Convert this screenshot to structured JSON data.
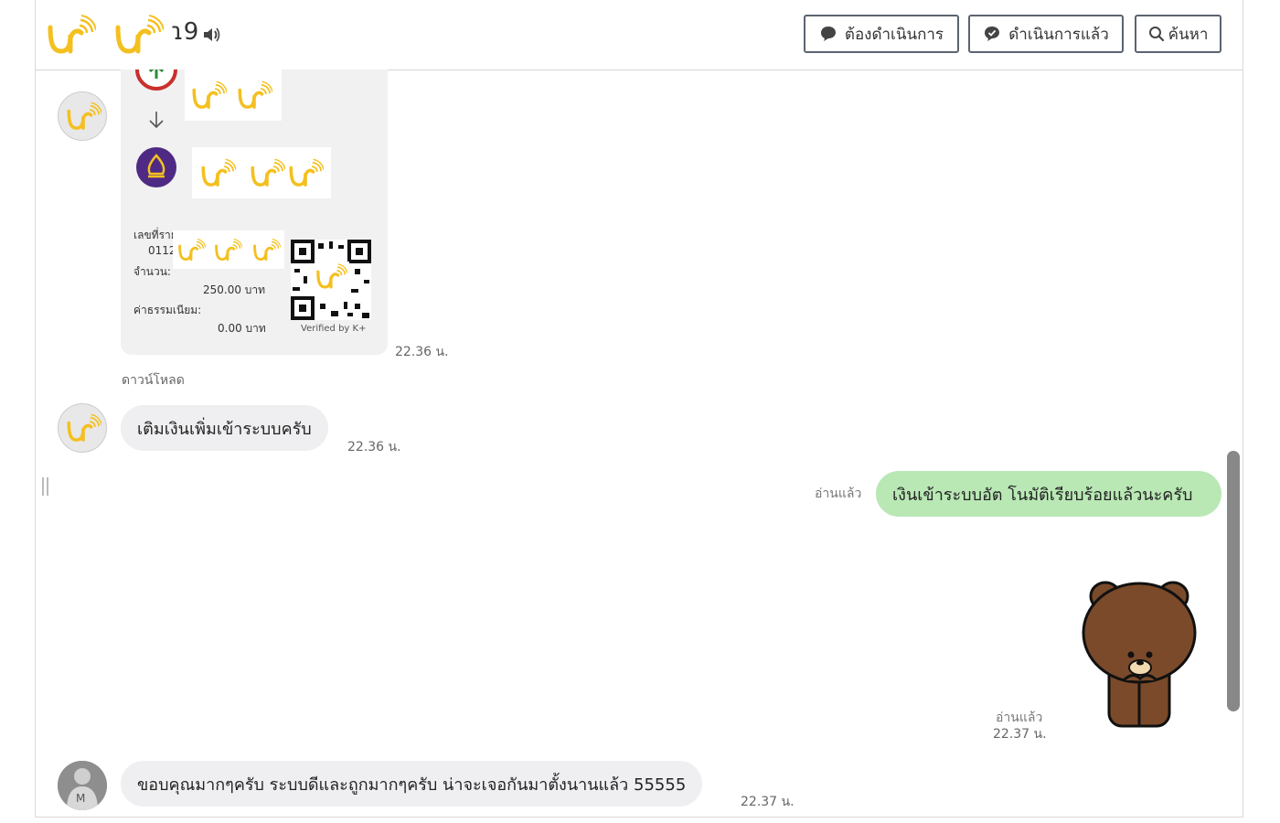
{
  "header": {
    "chat_name_suffix": "ɿ9",
    "buttons": {
      "pending": "ต้องดำเนินการ",
      "done": "ดำเนินการแล้ว",
      "search": "ค้นหา"
    }
  },
  "slip": {
    "ref_label": "เลขที่ราย",
    "ref_value": "0112",
    "amount_label": "จำนวน:",
    "amount_value": "250.00 บาท",
    "fee_label": "ค่าธรรมเนียม:",
    "fee_value": "0.00 บาท",
    "verified": "Verified by K+",
    "time": "22.36 น.",
    "download": "ดาวน์โหลด"
  },
  "messages": [
    {
      "text": "เติมเงินเพิ่มเข้าระบบครับ",
      "time": "22.36 น."
    },
    {
      "text": "เงินเข้าระบบอัต โนมัติเรียบร้อยแล้วนะครับ",
      "read": "อ่านแล้ว"
    },
    {
      "read": "อ่านแล้ว",
      "time": "22.37 น."
    },
    {
      "text": "ขอบคุณมากๆครับ ระบบดีและถูกมากๆครับ น่าจะเจอกันมาตั้งนานแล้ว 55555",
      "time": "22.37 น."
    }
  ],
  "colors": {
    "logo_yellow": "#f4c020",
    "incoming_bubble": "#efeff1",
    "outgoing_bubble": "#b9e8b5",
    "button_border": "#5b6470"
  },
  "icons": [
    "logo-icon",
    "speaker-icon",
    "chat-bubble-icon",
    "check-bubble-icon",
    "search-icon",
    "bank-icon",
    "arrow-down-icon",
    "qr-code-icon",
    "bear-sticker"
  ]
}
